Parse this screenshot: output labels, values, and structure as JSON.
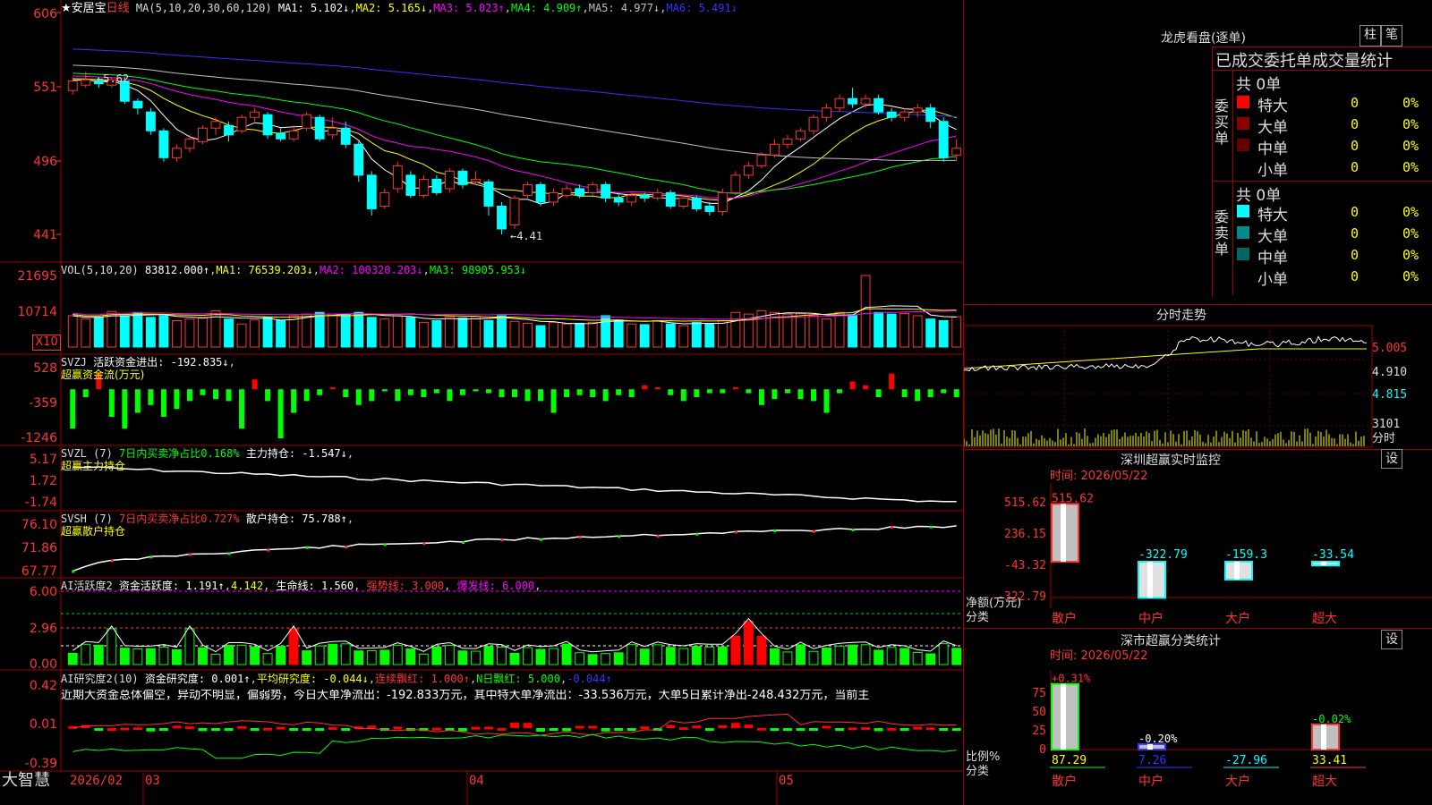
{
  "main": {
    "stock_name": "★安居宝",
    "period": "日线",
    "ma_params": "MA(5,10,20,30,60,120)",
    "ma_items": [
      {
        "label": "MA1: 5.102↓",
        "color": "#ffffff"
      },
      {
        "label": "MA2: 5.165↓",
        "color": "#ffff00"
      },
      {
        "label": "MA3: 5.023↑",
        "color": "#ff00ff"
      },
      {
        "label": "MA4: 4.909↑",
        "color": "#00ff00"
      },
      {
        "label": "MA5: 4.977↓",
        "color": "#c0c0c0"
      },
      {
        "label": "MA6: 5.491↓",
        "color": "#3333ff"
      }
    ],
    "y_ticks": [
      "606",
      "551",
      "496",
      "441"
    ],
    "high_label": "←5.62",
    "low_label": "←4.41"
  },
  "vol": {
    "title": "VOL(5,10,20)",
    "value": "83812.000↑",
    "ma1": "MA1: 76539.203↓",
    "ma2": "MA2: 100320.203↓",
    "ma3": "MA3: 98905.953↓",
    "y_ticks": [
      "21695",
      "10714"
    ],
    "unit": "X10"
  },
  "svzj": {
    "title": "SVZJ",
    "label": "活跃资金进出: -192.835↓",
    "sub": "超赢资金流(万元)",
    "y_ticks": [
      "528",
      "-359",
      "-1246"
    ]
  },
  "svzl": {
    "title": "SVZL (7)",
    "ratio": "7日内买卖净占比0.168%",
    "holding": "主力持仓: -1.547↓",
    "sub": "超赢主力持仓",
    "y_ticks": [
      "5.17",
      "1.72",
      "-1.74"
    ]
  },
  "svsh": {
    "title": "SVSH (7)",
    "ratio": "7日内买卖净占比0.727%",
    "holding": "散户持仓: 75.788↑",
    "sub": "超赢散户持仓",
    "y_ticks": [
      "76.10",
      "71.86",
      "67.77"
    ]
  },
  "ai_active": {
    "title": "AI活跃度2",
    "fund": "资金活跃度: 1.191↑",
    "v2": "4.142",
    "life": "生命线: 1.560",
    "strong": "强势线: 3.000",
    "burst": "爆发线: 6.000",
    "y_ticks": [
      "6.00",
      "2.96",
      "0.00"
    ]
  },
  "ai_research": {
    "title": "AI研究度2(10)",
    "fund": "资金研究度: 0.001↑",
    "avg": "平均研究度: -0.044↓",
    "cont": "连续飘红: 1.000↑",
    "n_red": "N日飘红: 5.000",
    "last": "-0.044↑",
    "comment": "近期大资金总体偏空，异动不明显，偏弱势，今日大单净流出：-192.833万元，其中特大单净流出：-33.536万元，大单5日累计净出-248.432万元，当前主",
    "y_ticks": [
      "0.42",
      "0.01",
      "-0.39"
    ]
  },
  "footer": {
    "brand": "大智慧",
    "dates": [
      "2026/02",
      "03",
      "04",
      "05"
    ]
  },
  "dragon": {
    "title": "龙虎看盘(逐单)",
    "btn_bar": "柱",
    "btn_deal": "笔",
    "header": "已成交委托单成交量统计",
    "buy_label": "委买单",
    "sell_label": "委卖单",
    "buy_total": "共 0单",
    "sell_total": "共 0单",
    "buy_rows": [
      {
        "name": "特大",
        "val": "0",
        "pct": "0%",
        "color": "#ff0000"
      },
      {
        "name": "大单",
        "val": "0",
        "pct": "0%",
        "color": "#8b0000"
      },
      {
        "name": "中单",
        "val": "0",
        "pct": "0%",
        "color": "#660000"
      },
      {
        "name": "小单",
        "val": "0",
        "pct": "0%",
        "color": "#000000"
      }
    ],
    "sell_rows": [
      {
        "name": "特大",
        "val": "0",
        "pct": "0%",
        "color": "#00ffff"
      },
      {
        "name": "大单",
        "val": "0",
        "pct": "0%",
        "color": "#008b8b"
      },
      {
        "name": "中单",
        "val": "0",
        "pct": "0%",
        "color": "#006666"
      },
      {
        "name": "小单",
        "val": "0",
        "pct": "0%",
        "color": "#000000"
      }
    ]
  },
  "intraday": {
    "title": "分时走势",
    "y_ticks": [
      "5.005",
      "4.910",
      "4.815"
    ],
    "vol_tick": "3101",
    "vol_unit": "分时"
  },
  "sz_monitor": {
    "title": "深圳超赢实时监控",
    "btn": "设",
    "time": "时间: 2026/05/22",
    "y_ticks": [
      "515.62",
      "236.15",
      "-43.32",
      "-322.79"
    ],
    "ylabel": "净额(万元)",
    "xlabel": "分类"
  },
  "sz_stats": {
    "title": "深市超赢分类统计",
    "btn": "设",
    "time": "时间: 2026/05/22",
    "y_ticks": [
      "75",
      "50",
      "25",
      "0"
    ],
    "ylabel": "比例%",
    "xlabel": "分类"
  },
  "chart_data": [
    {
      "type": "candlestick",
      "title": "安居宝 日线",
      "ylim": [
        4.41,
        6.06
      ],
      "candles": [
        [
          5.48,
          5.55,
          5.58,
          5.45
        ],
        [
          5.52,
          5.56,
          5.62,
          5.5
        ],
        [
          5.55,
          5.53,
          5.58,
          5.5
        ],
        [
          5.52,
          5.56,
          5.58,
          5.5
        ],
        [
          5.55,
          5.4,
          5.58,
          5.38
        ],
        [
          5.4,
          5.35,
          5.42,
          5.3
        ],
        [
          5.32,
          5.18,
          5.35,
          5.15
        ],
        [
          5.18,
          4.98,
          5.2,
          4.95
        ],
        [
          4.98,
          5.05,
          5.08,
          4.95
        ],
        [
          5.05,
          5.12,
          5.15,
          5.02
        ],
        [
          5.1,
          5.2,
          5.22,
          5.08
        ],
        [
          5.2,
          5.25,
          5.28,
          5.15
        ],
        [
          5.22,
          5.15,
          5.25,
          5.1
        ],
        [
          5.18,
          5.28,
          5.3,
          5.16
        ],
        [
          5.28,
          5.32,
          5.35,
          5.25
        ],
        [
          5.3,
          5.15,
          5.32,
          5.12
        ],
        [
          5.16,
          5.12,
          5.2,
          5.1
        ],
        [
          5.12,
          5.18,
          5.22,
          5.1
        ],
        [
          5.2,
          5.3,
          5.32,
          5.18
        ],
        [
          5.28,
          5.12,
          5.3,
          5.1
        ],
        [
          5.15,
          5.2,
          5.28,
          5.12
        ],
        [
          5.2,
          5.08,
          5.25,
          5.05
        ],
        [
          5.08,
          4.85,
          5.1,
          4.8
        ],
        [
          4.85,
          4.6,
          4.88,
          4.55
        ],
        [
          4.62,
          4.72,
          4.75,
          4.6
        ],
        [
          4.75,
          4.92,
          4.95,
          4.72
        ],
        [
          4.85,
          4.7,
          4.88,
          4.68
        ],
        [
          4.7,
          4.82,
          4.85,
          4.68
        ],
        [
          4.82,
          4.72,
          4.85,
          4.7
        ],
        [
          4.75,
          4.88,
          4.9,
          4.72
        ],
        [
          4.88,
          4.78,
          4.9,
          4.75
        ],
        [
          4.8,
          4.82,
          4.88,
          4.78
        ],
        [
          4.8,
          4.62,
          4.82,
          4.55
        ],
        [
          4.62,
          4.45,
          4.65,
          4.41
        ],
        [
          4.48,
          4.68,
          4.7,
          4.45
        ],
        [
          4.7,
          4.78,
          4.8,
          4.68
        ],
        [
          4.78,
          4.65,
          4.8,
          4.62
        ],
        [
          4.65,
          4.72,
          4.75,
          4.62
        ],
        [
          4.7,
          4.75,
          4.78,
          4.68
        ],
        [
          4.75,
          4.7,
          4.78,
          4.68
        ],
        [
          4.72,
          4.78,
          4.8,
          4.7
        ],
        [
          4.78,
          4.68,
          4.8,
          4.65
        ],
        [
          4.68,
          4.65,
          4.72,
          4.62
        ],
        [
          4.65,
          4.7,
          4.72,
          4.62
        ],
        [
          4.7,
          4.68,
          4.72,
          4.65
        ],
        [
          4.68,
          4.72,
          4.75,
          4.66
        ],
        [
          4.72,
          4.62,
          4.74,
          4.6
        ],
        [
          4.62,
          4.68,
          4.7,
          4.6
        ],
        [
          4.68,
          4.6,
          4.7,
          4.58
        ],
        [
          4.62,
          4.58,
          4.65,
          4.55
        ],
        [
          4.58,
          4.72,
          4.75,
          4.55
        ],
        [
          4.72,
          4.85,
          4.88,
          4.7
        ],
        [
          4.85,
          4.92,
          4.95,
          4.82
        ],
        [
          4.92,
          5.0,
          5.02,
          4.9
        ],
        [
          5.0,
          5.08,
          5.12,
          4.98
        ],
        [
          5.08,
          5.12,
          5.15,
          5.05
        ],
        [
          5.12,
          5.18,
          5.2,
          5.1
        ],
        [
          5.18,
          5.28,
          5.3,
          5.15
        ],
        [
          5.28,
          5.35,
          5.38,
          5.25
        ],
        [
          5.35,
          5.42,
          5.45,
          5.32
        ],
        [
          5.42,
          5.38,
          5.5,
          5.35
        ],
        [
          5.38,
          5.42,
          5.45,
          5.35
        ],
        [
          5.42,
          5.32,
          5.45,
          5.3
        ],
        [
          5.32,
          5.28,
          5.35,
          5.25
        ],
        [
          5.28,
          5.32,
          5.35,
          5.25
        ],
        [
          5.32,
          5.35,
          5.38,
          5.28
        ],
        [
          5.35,
          5.25,
          5.38,
          5.2
        ],
        [
          5.25,
          4.98,
          5.28,
          4.95
        ],
        [
          5.0,
          5.05,
          5.12,
          4.96
        ]
      ]
    },
    {
      "type": "bar",
      "title": "VOL(5,10,20)",
      "ylim": [
        0,
        21695
      ],
      "values": [
        9500,
        8500,
        9000,
        10800,
        9500,
        10500,
        9000,
        9500,
        8000,
        8500,
        9000,
        11000,
        8500,
        7000,
        8200,
        9000,
        8000,
        9500,
        10000,
        10500,
        10000,
        9800,
        10500,
        9000,
        8500,
        9500,
        9000,
        7500,
        8000,
        9200,
        8800,
        9200,
        8000,
        9500,
        7800,
        7200,
        6500,
        7500,
        7000,
        7200,
        7500,
        9500,
        8200,
        7000,
        6800,
        8000,
        7000,
        6500,
        7500,
        7000,
        8000,
        10500,
        10000,
        11000,
        10500,
        10000,
        10200,
        9500,
        8500,
        10500,
        9800,
        21695,
        10500,
        10000,
        10200,
        9500,
        8500,
        8000,
        9200
      ]
    },
    {
      "type": "bar",
      "title": "超赢资金流(万元)",
      "ylim": [
        -1246,
        528
      ],
      "values": [
        -1000,
        -200,
        400,
        -700,
        -1000,
        -600,
        -400,
        -700,
        -500,
        -300,
        -150,
        -250,
        -300,
        -1000,
        250,
        -300,
        -1246,
        -600,
        -300,
        -150,
        50,
        -200,
        -400,
        -300,
        -50,
        -300,
        -150,
        -200,
        -100,
        -300,
        -150,
        -50,
        -100,
        -200,
        -200,
        -300,
        -300,
        -600,
        -200,
        -150,
        -200,
        -300,
        -150,
        -200,
        100,
        50,
        -150,
        -300,
        -200,
        -100,
        -100,
        50,
        -100,
        -400,
        -250,
        -100,
        -250,
        -300,
        -600,
        -100,
        200,
        100,
        -200,
        400,
        -200,
        -300,
        -200,
        -100,
        -200
      ]
    }
  ]
}
